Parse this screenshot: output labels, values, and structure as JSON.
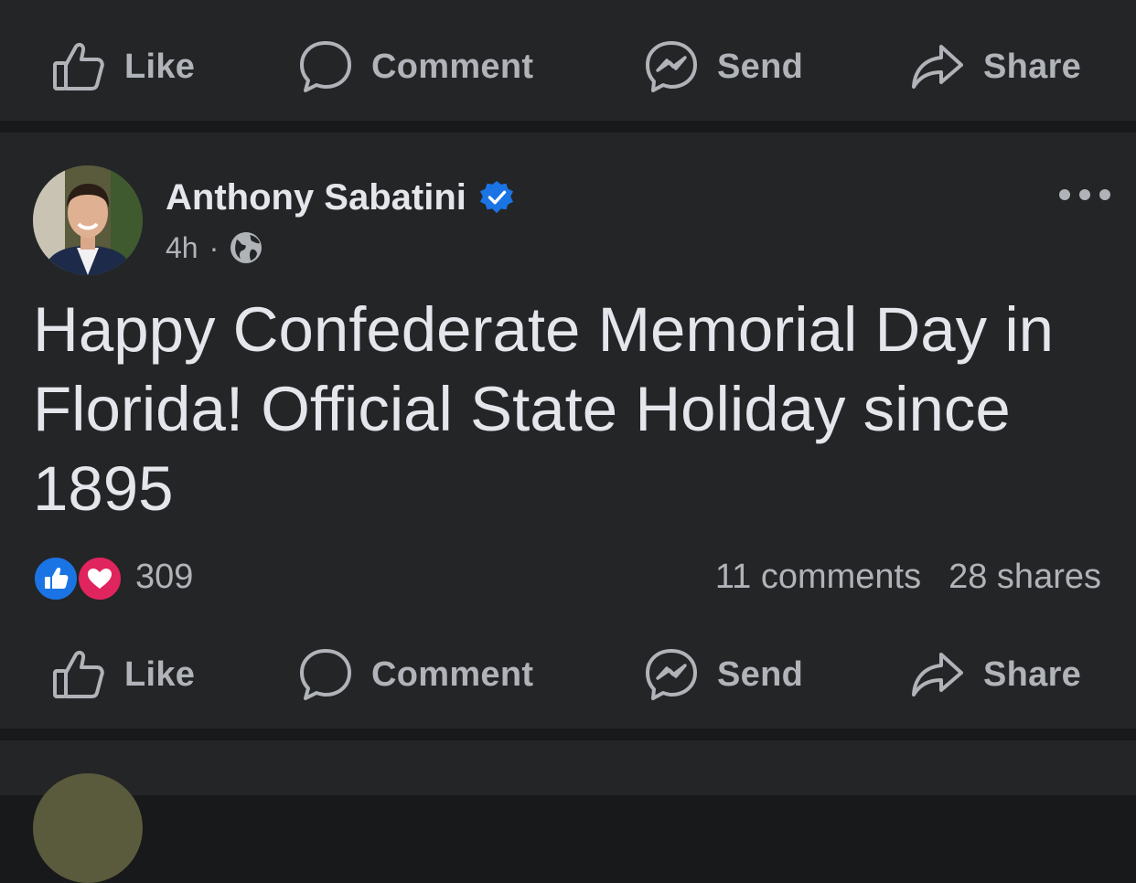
{
  "actions": {
    "like_label": "Like",
    "comment_label": "Comment",
    "send_label": "Send",
    "share_label": "Share"
  },
  "post": {
    "author": "Anthony Sabatini",
    "time": "4h",
    "separator": "·",
    "text": "Happy Confederate Memorial Day in Florida! Official State Holiday since 1895",
    "reaction_count": "309",
    "comments": "11 comments",
    "shares": "28 shares"
  },
  "colors": {
    "background": "#18191b",
    "card": "#242527",
    "text_primary": "#e4e6eb",
    "text_secondary": "#b0b3b8",
    "verified_blue": "#1b74e4",
    "like_blue": "#1b74e4",
    "love_red": "#e0245e"
  },
  "icons": {
    "like": "thumbs-up-icon",
    "comment": "speech-bubble-icon",
    "send": "messenger-icon",
    "share": "share-arrow-icon",
    "verified": "verified-badge-icon",
    "privacy": "globe-icon",
    "more": "ellipsis-icon"
  }
}
